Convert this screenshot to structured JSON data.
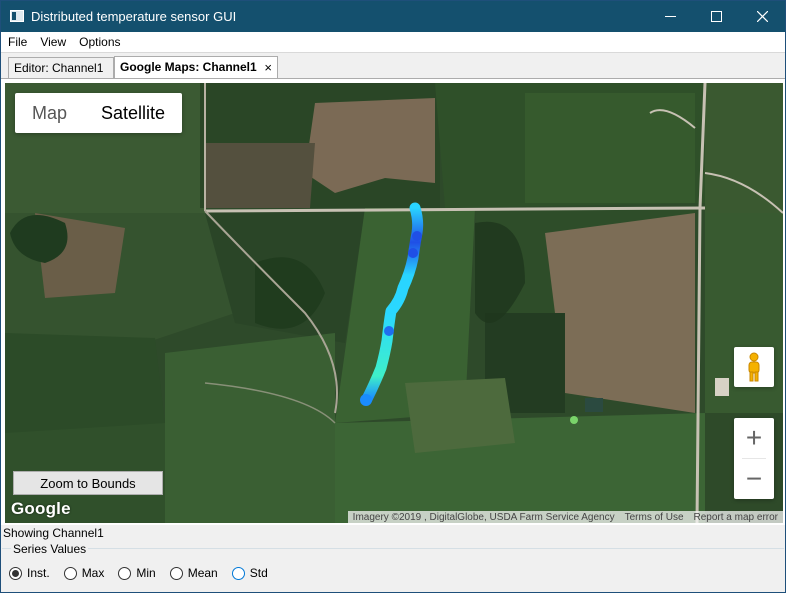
{
  "window": {
    "title": "Distributed temperature sensor GUI",
    "controls": {
      "minimize": "minimize-icon",
      "maximize": "maximize-icon",
      "close": "close-icon"
    }
  },
  "menu": {
    "items": [
      "File",
      "View",
      "Options"
    ]
  },
  "tabs": [
    {
      "label": "Editor: Channel1",
      "active": false
    },
    {
      "label": "Google Maps: Channel1",
      "active": true,
      "close": "×"
    }
  ],
  "map": {
    "maptype": {
      "map_label": "Map",
      "satellite_label": "Satellite",
      "selected": "Satellite"
    },
    "zoom": {
      "in_label": "+",
      "out_label": "−"
    },
    "pegman_icon": "pegman-icon",
    "zoom_bounds_label": "Zoom to Bounds",
    "logo": "Google",
    "attribution": {
      "imagery": "Imagery ©2019 , DigitalGlobe, USDA Farm Service Agency",
      "terms": "Terms of Use",
      "report": "Report a map error"
    },
    "track_colors": {
      "start": "#1a8cff",
      "mid": "#29d4ff",
      "end": "#3ff0c8",
      "deep": "#1f4fe6"
    }
  },
  "status": {
    "showing": "Showing Channel1"
  },
  "series": {
    "legend": "Series Values",
    "options": [
      {
        "label": "Inst.",
        "checked": true
      },
      {
        "label": "Max",
        "checked": false
      },
      {
        "label": "Min",
        "checked": false
      },
      {
        "label": "Mean",
        "checked": false
      },
      {
        "label": "Std",
        "checked": false,
        "focused": true
      }
    ]
  }
}
